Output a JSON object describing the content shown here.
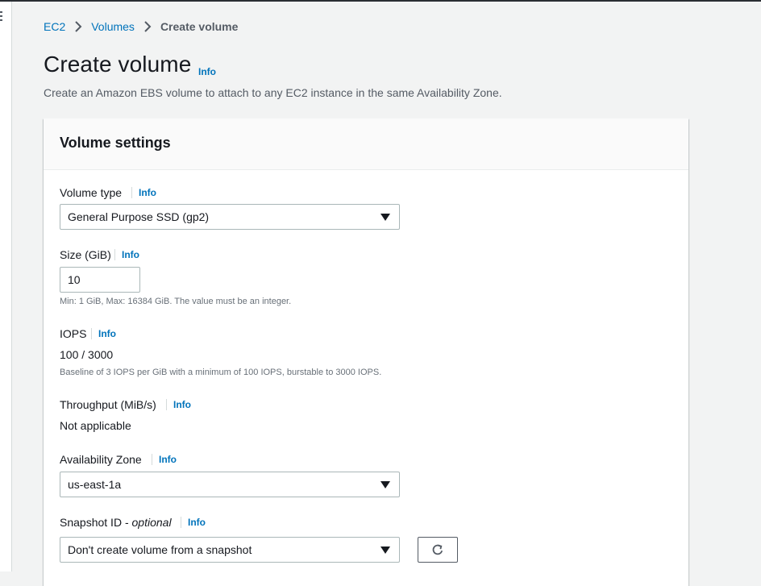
{
  "breadcrumb": {
    "items": [
      "EC2",
      "Volumes"
    ],
    "current": "Create volume"
  },
  "page": {
    "title": "Create volume",
    "info": "Info",
    "description": "Create an Amazon EBS volume to attach to any EC2 instance in the same Availability Zone."
  },
  "panel": {
    "title": "Volume settings"
  },
  "fields": {
    "volume_type": {
      "label": "Volume type",
      "info": "Info",
      "value": "General Purpose SSD (gp2)"
    },
    "size": {
      "label": "Size (GiB)",
      "info": "Info",
      "value": "10",
      "hint": "Min: 1 GiB, Max: 16384 GiB. The value must be an integer."
    },
    "iops": {
      "label": "IOPS",
      "info": "Info",
      "value": "100 / 3000",
      "hint": "Baseline of 3 IOPS per GiB with a minimum of 100 IOPS, burstable to 3000 IOPS."
    },
    "throughput": {
      "label": "Throughput (MiB/s)",
      "info": "Info",
      "value": "Not applicable"
    },
    "availability_zone": {
      "label": "Availability Zone",
      "info": "Info",
      "value": "us-east-1a"
    },
    "snapshot": {
      "label": "Snapshot ID",
      "label_suffix": "optional",
      "info": "Info",
      "value": "Don't create volume from a snapshot"
    }
  },
  "icons": {
    "breadcrumb_separator": "chevron-right-icon",
    "select_caret": "caret-down-icon",
    "refresh": "refresh-icon"
  },
  "colors": {
    "link": "#0073bb",
    "text": "#16191f",
    "muted": "#545b64",
    "background": "#f2f3f3"
  }
}
